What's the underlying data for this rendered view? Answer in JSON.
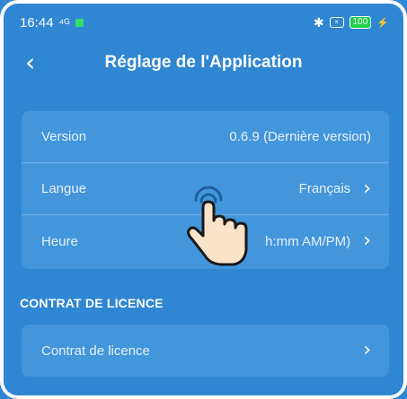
{
  "status_bar": {
    "time": "16:44",
    "battery": "100"
  },
  "header": {
    "title": "Réglage de l'Application"
  },
  "settings": {
    "rows": [
      {
        "label": "Version",
        "value": "0.6.9 (Dernière version)",
        "has_chevron": false
      },
      {
        "label": "Langue",
        "value": "Français",
        "has_chevron": true
      },
      {
        "label": "Heure",
        "value": "h:mm AM/PM)",
        "has_chevron": true
      }
    ]
  },
  "license": {
    "section_title": "CONTRAT DE LICENCE",
    "row_label": "Contrat de licence"
  },
  "colors": {
    "background": "#2f86d3",
    "card": "#4496dc",
    "text": "#ffffff"
  },
  "icons": [
    "back-icon",
    "chevron-right-icon",
    "bluetooth-icon",
    "battery-icon",
    "tap-hand-icon"
  ]
}
